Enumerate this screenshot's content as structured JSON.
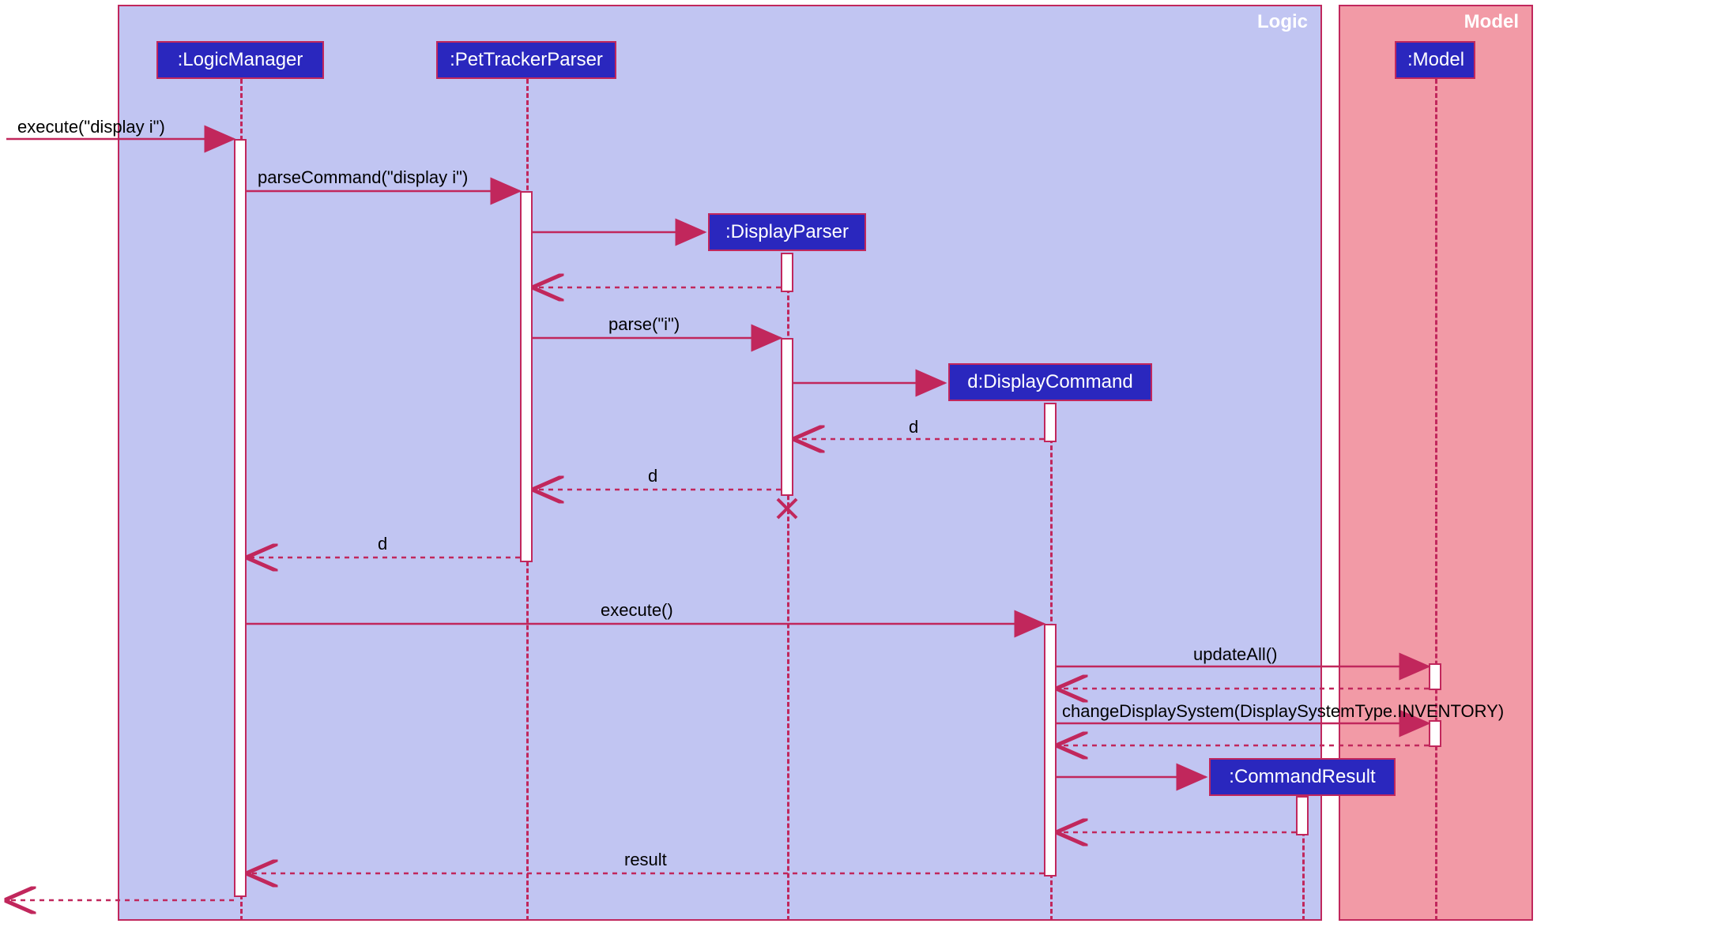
{
  "frames": {
    "logic": "Logic",
    "model": "Model"
  },
  "participants": {
    "logicManager": ":LogicManager",
    "petTrackerParser": ":PetTrackerParser",
    "displayParser": ":DisplayParser",
    "displayCommand": "d:DisplayCommand",
    "model": ":Model",
    "commandResult": ":CommandResult"
  },
  "messages": {
    "m1": "execute(\"display i\")",
    "m2": "parseCommand(\"display i\")",
    "m3": "parse(\"i\")",
    "m4": "d",
    "m5": "d",
    "m6": "d",
    "m7": "execute()",
    "m8": "updateAll()",
    "m9": "changeDisplaySystem(DisplaySystemType.INVENTORY)",
    "m10": "result"
  }
}
